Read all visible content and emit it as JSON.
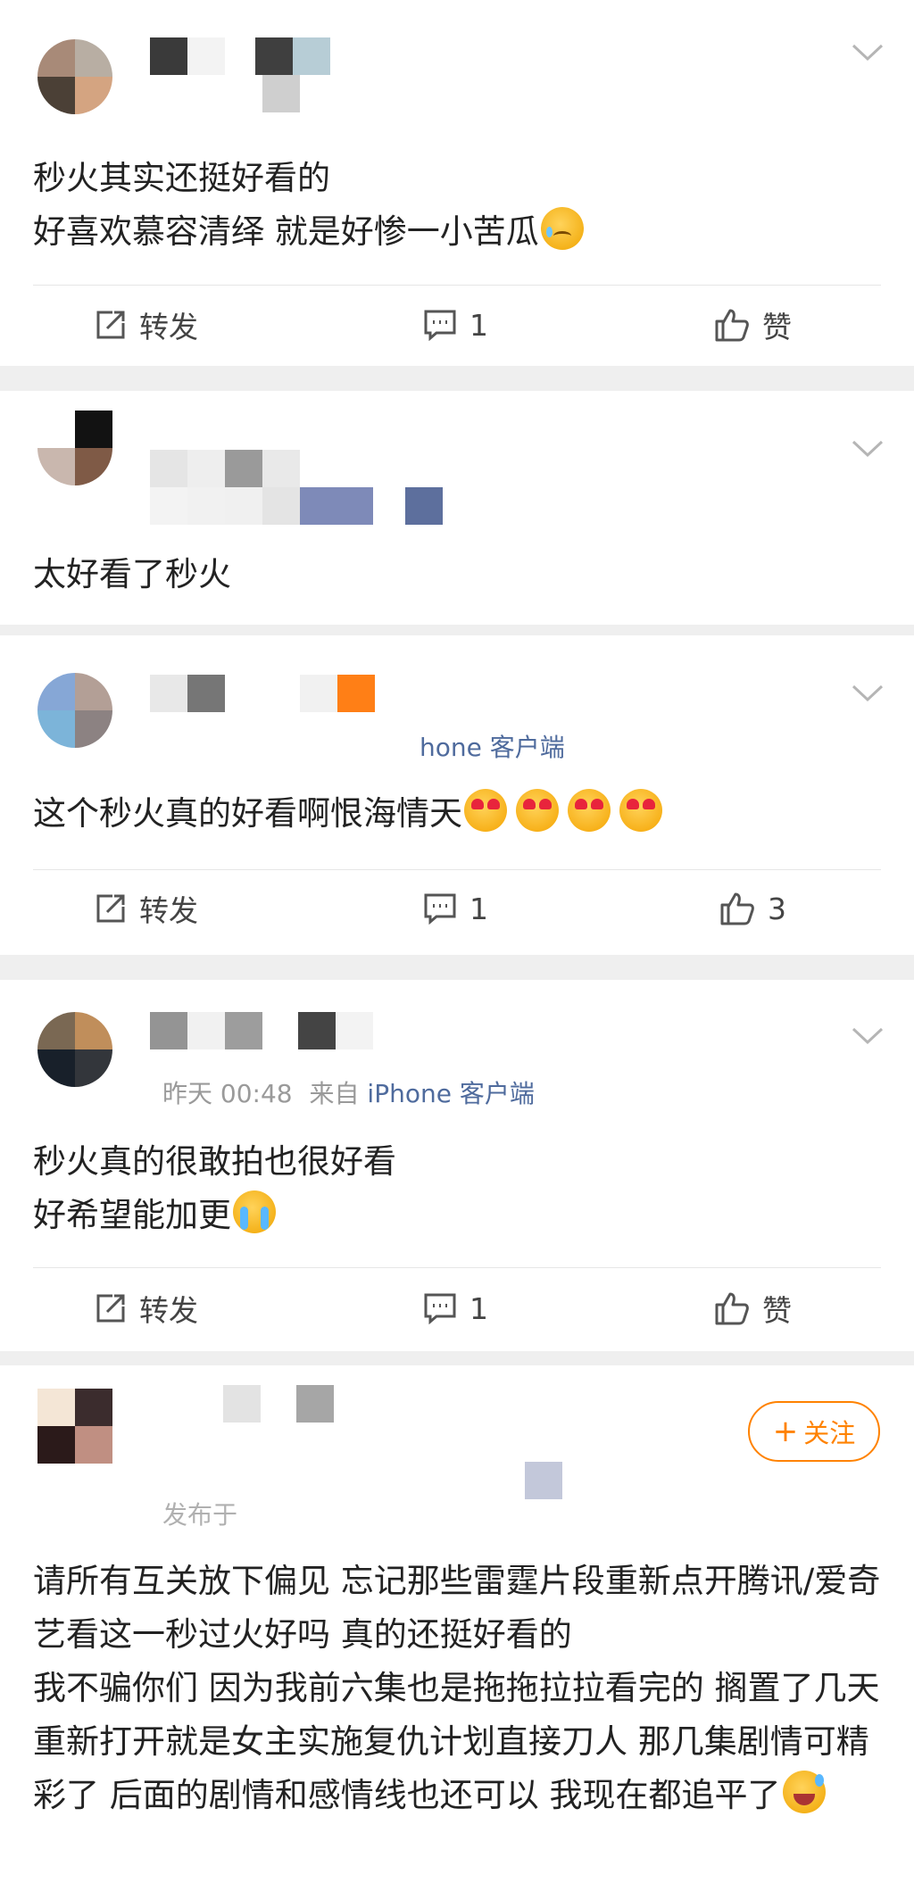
{
  "colors": {
    "accent": "#ff8200",
    "source_link": "#4f6b9d",
    "meta_gray": "#9a9a9a",
    "separator": "#efefef"
  },
  "actions": {
    "repost_label": "转发",
    "like_label": "赞"
  },
  "posts": [
    {
      "meta_time": "",
      "meta_source": "",
      "text": "秒火其实还挺好看的\n好喜欢慕容清绎 就是好惨一小苦瓜",
      "emoji": "sad-tear-emoji",
      "comment_count": "1",
      "like_value": "赞"
    },
    {
      "meta_time": "",
      "meta_source": "",
      "text": "太好看了秒火"
    },
    {
      "meta_time": "",
      "meta_source": "hone 客户端",
      "text": "这个秒火真的好看啊恨海情天",
      "emoji": "heart-eyes-emoji",
      "emoji_count": 4,
      "comment_count": "1",
      "like_value": "3"
    },
    {
      "meta_time": "昨天 00:48",
      "meta_from": "来自",
      "meta_source": "iPhone 客户端",
      "text": "秒火真的很敢拍也很好看\n好希望能加更",
      "emoji": "crying-emoji",
      "comment_count": "1",
      "like_value": "赞"
    },
    {
      "meta_time": "发布于",
      "follow_label": "关注",
      "text": "请所有互关放下偏见 忘记那些雷霆片段重新点开腾讯/爱奇艺看这一秒过火好吗 真的还挺好看的\n我不骗你们 因为我前六集也是拖拖拉拉看完的 搁置了几天重新打开就是女主实施复仇计划直接刀人 那几集剧情可精彩了 后面的剧情和感情线也还可以 我现在都追平了",
      "emoji": "laughing-sweat-emoji"
    }
  ]
}
